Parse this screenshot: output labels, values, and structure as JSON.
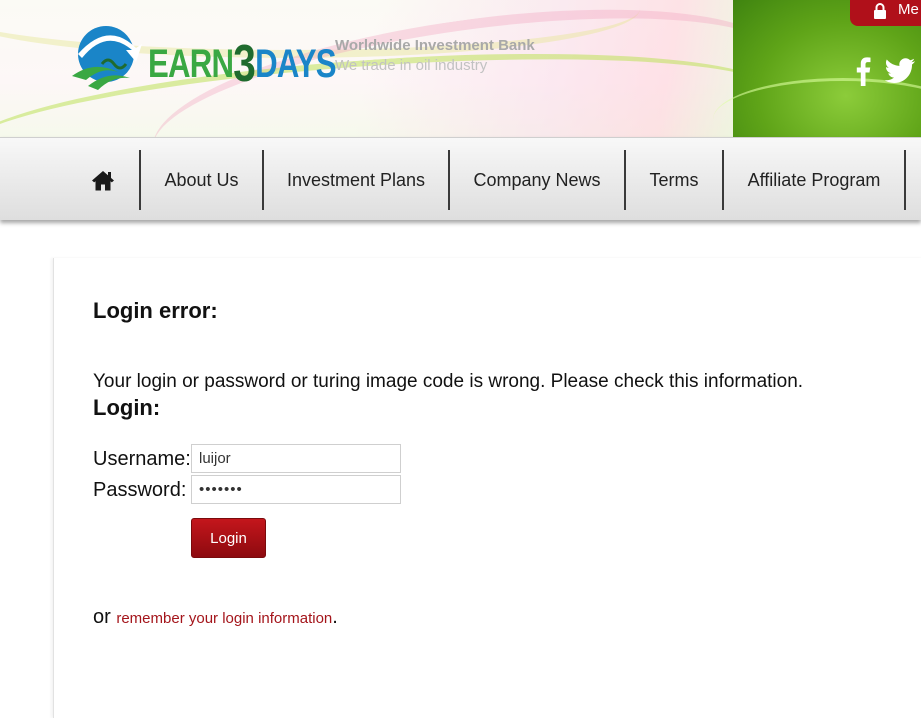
{
  "header": {
    "brand": {
      "earn": "EARN",
      "number": "3",
      "days": "DAYS"
    },
    "tagline_title": "Worldwide Investment Bank",
    "tagline_sub": "We trade in oil industry",
    "member_button_label": "Me",
    "colors": {
      "accent_red": "#b0101a",
      "green_panel": "#5fa418",
      "brand_blue": "#1a85c8",
      "brand_green": "#3aa843"
    }
  },
  "nav": {
    "home_icon": "home-icon",
    "items": [
      {
        "label": "About Us"
      },
      {
        "label": "Investment Plans"
      },
      {
        "label": "Company News"
      },
      {
        "label": "Terms"
      },
      {
        "label": "Affiliate Program"
      }
    ]
  },
  "main": {
    "error_heading": "Login error:",
    "error_message": "Your login or password or turing image code is wrong. Please check this information.",
    "login_heading": "Login:",
    "username_label": "Username:",
    "username_value": "luijor",
    "password_label": "Password:",
    "password_value": "•••••••",
    "login_button": "Login",
    "remember_prefix": "or ",
    "remember_link": "remember your login information",
    "remember_suffix": "."
  }
}
